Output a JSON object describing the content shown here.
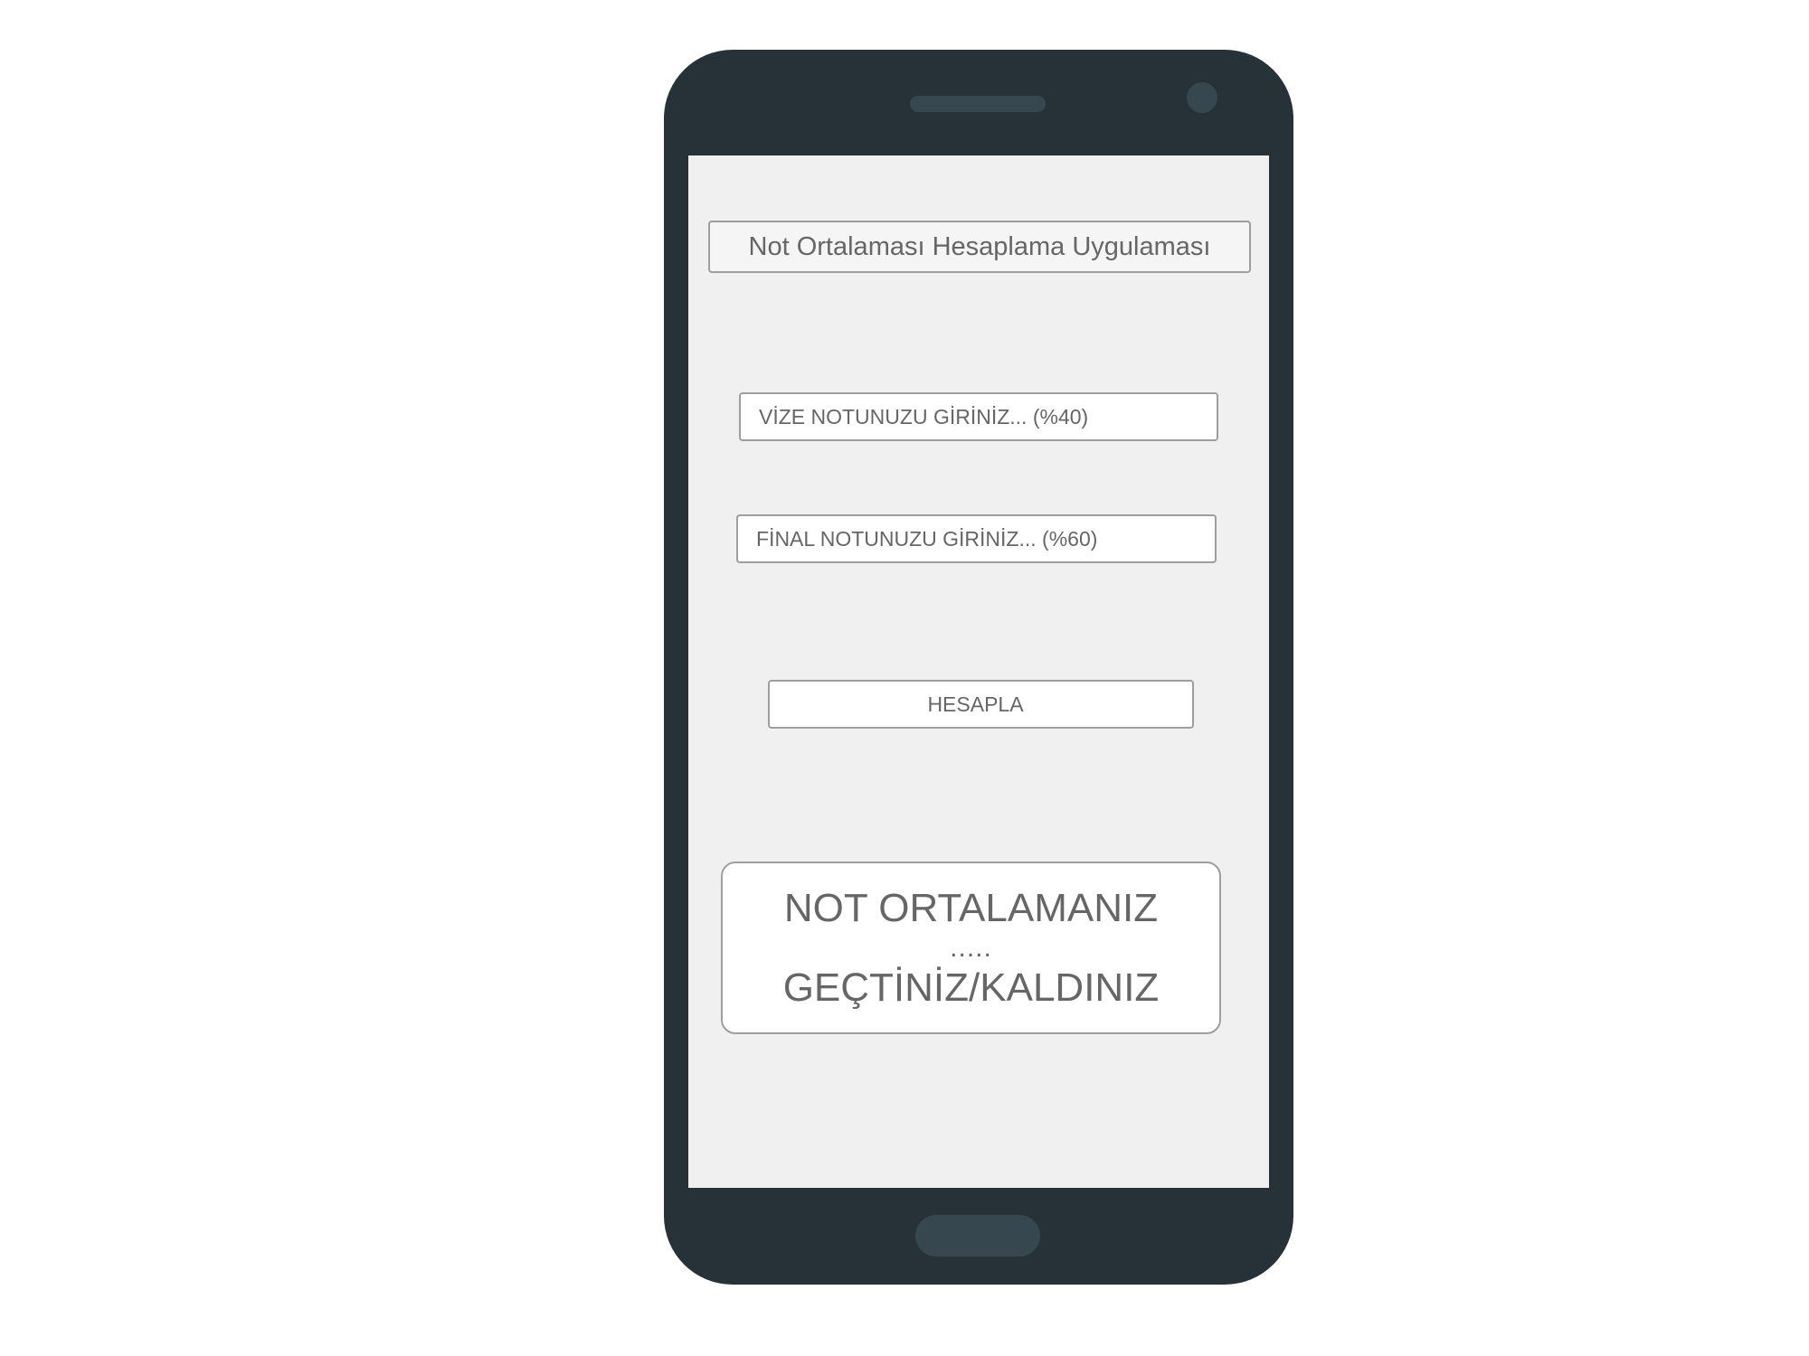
{
  "app": {
    "title": "Not Ortalaması Hesaplama Uygulaması"
  },
  "form": {
    "vize_placeholder": "VİZE NOTUNUZU GİRİNİZ... (%40)",
    "final_placeholder": "FİNAL NOTUNUZU GİRİNİZ... (%60)",
    "calculate_label": "HESAPLA"
  },
  "result": {
    "heading": "NOT ORTALAMANIZ",
    "value": ".....",
    "status": "GEÇTİNİZ/KALDINIZ"
  },
  "colors": {
    "phone_body": "#263238",
    "phone_accent": "#37474f",
    "screen_background": "#f0f0f0",
    "text": "#666666",
    "border": "#9e9e9e"
  },
  "icons": {
    "speaker": "speaker-grille-icon",
    "camera": "front-camera-icon",
    "home": "home-button-icon"
  }
}
